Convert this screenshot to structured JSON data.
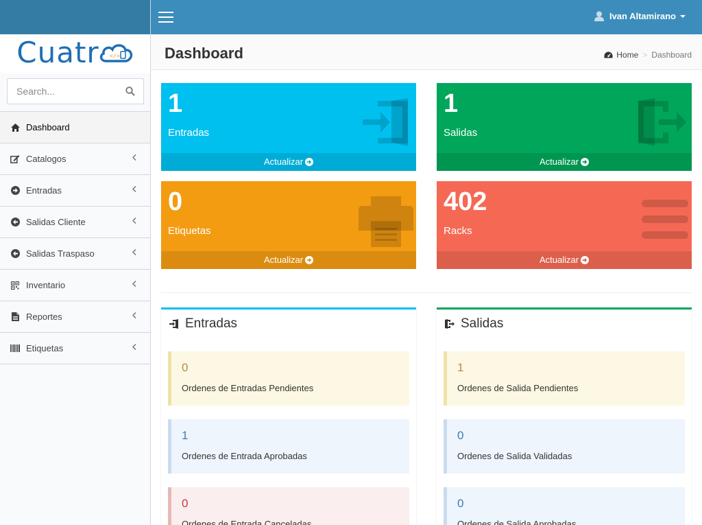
{
  "brand": {
    "logo_text": "Cuatr"
  },
  "header": {
    "user_name": "Ivan Altamirano"
  },
  "sidebar": {
    "search_placeholder": "Search...",
    "items": [
      {
        "label": "Dashboard",
        "icon": "home-icon",
        "active": true
      },
      {
        "label": "Catalogos",
        "icon": "edit-icon"
      },
      {
        "label": "Entradas",
        "icon": "arrow-circle-right-icon"
      },
      {
        "label": "Salidas Cliente",
        "icon": "arrow-circle-left-icon"
      },
      {
        "label": "Salidas Traspaso",
        "icon": "arrow-circle-left-icon"
      },
      {
        "label": "Inventario",
        "icon": "qrcode-icon"
      },
      {
        "label": "Reportes",
        "icon": "file-icon"
      },
      {
        "label": "Etiquetas",
        "icon": "barcode-icon"
      }
    ]
  },
  "content_header": {
    "title": "Dashboard",
    "breadcrumb": {
      "home": "Home",
      "current": "Dashboard"
    }
  },
  "stats": [
    {
      "value": "1",
      "label": "Entradas",
      "footer": "Actualizar",
      "color": "#00c0ef",
      "icon": "sign-in-icon"
    },
    {
      "value": "1",
      "label": "Salidas",
      "footer": "Actualizar",
      "color": "#00a65a",
      "icon": "sign-out-icon"
    },
    {
      "value": "0",
      "label": "Etiquetas",
      "footer": "Actualizar",
      "color": "#f39c12",
      "icon": "print-icon"
    },
    {
      "value": "402",
      "label": "Racks",
      "footer": "Actualizar",
      "color": "#f56954",
      "icon": "bars-icon"
    }
  ],
  "panels": {
    "entradas": {
      "title": "Entradas",
      "items": [
        {
          "value": "0",
          "label": "Ordenes de Entradas Pendientes"
        },
        {
          "value": "1",
          "label": "Ordenes de Entrada Aprobadas"
        },
        {
          "value": "0",
          "label": "Ordenes de Entrada Canceladas"
        }
      ]
    },
    "salidas": {
      "title": "Salidas",
      "items": [
        {
          "value": "1",
          "label": "Ordenes de Salida Pendientes"
        },
        {
          "value": "0",
          "label": "Ordenes de Salida Validadas"
        },
        {
          "value": "0",
          "label": "Ordenes de Salida Aprobadas"
        }
      ]
    }
  }
}
